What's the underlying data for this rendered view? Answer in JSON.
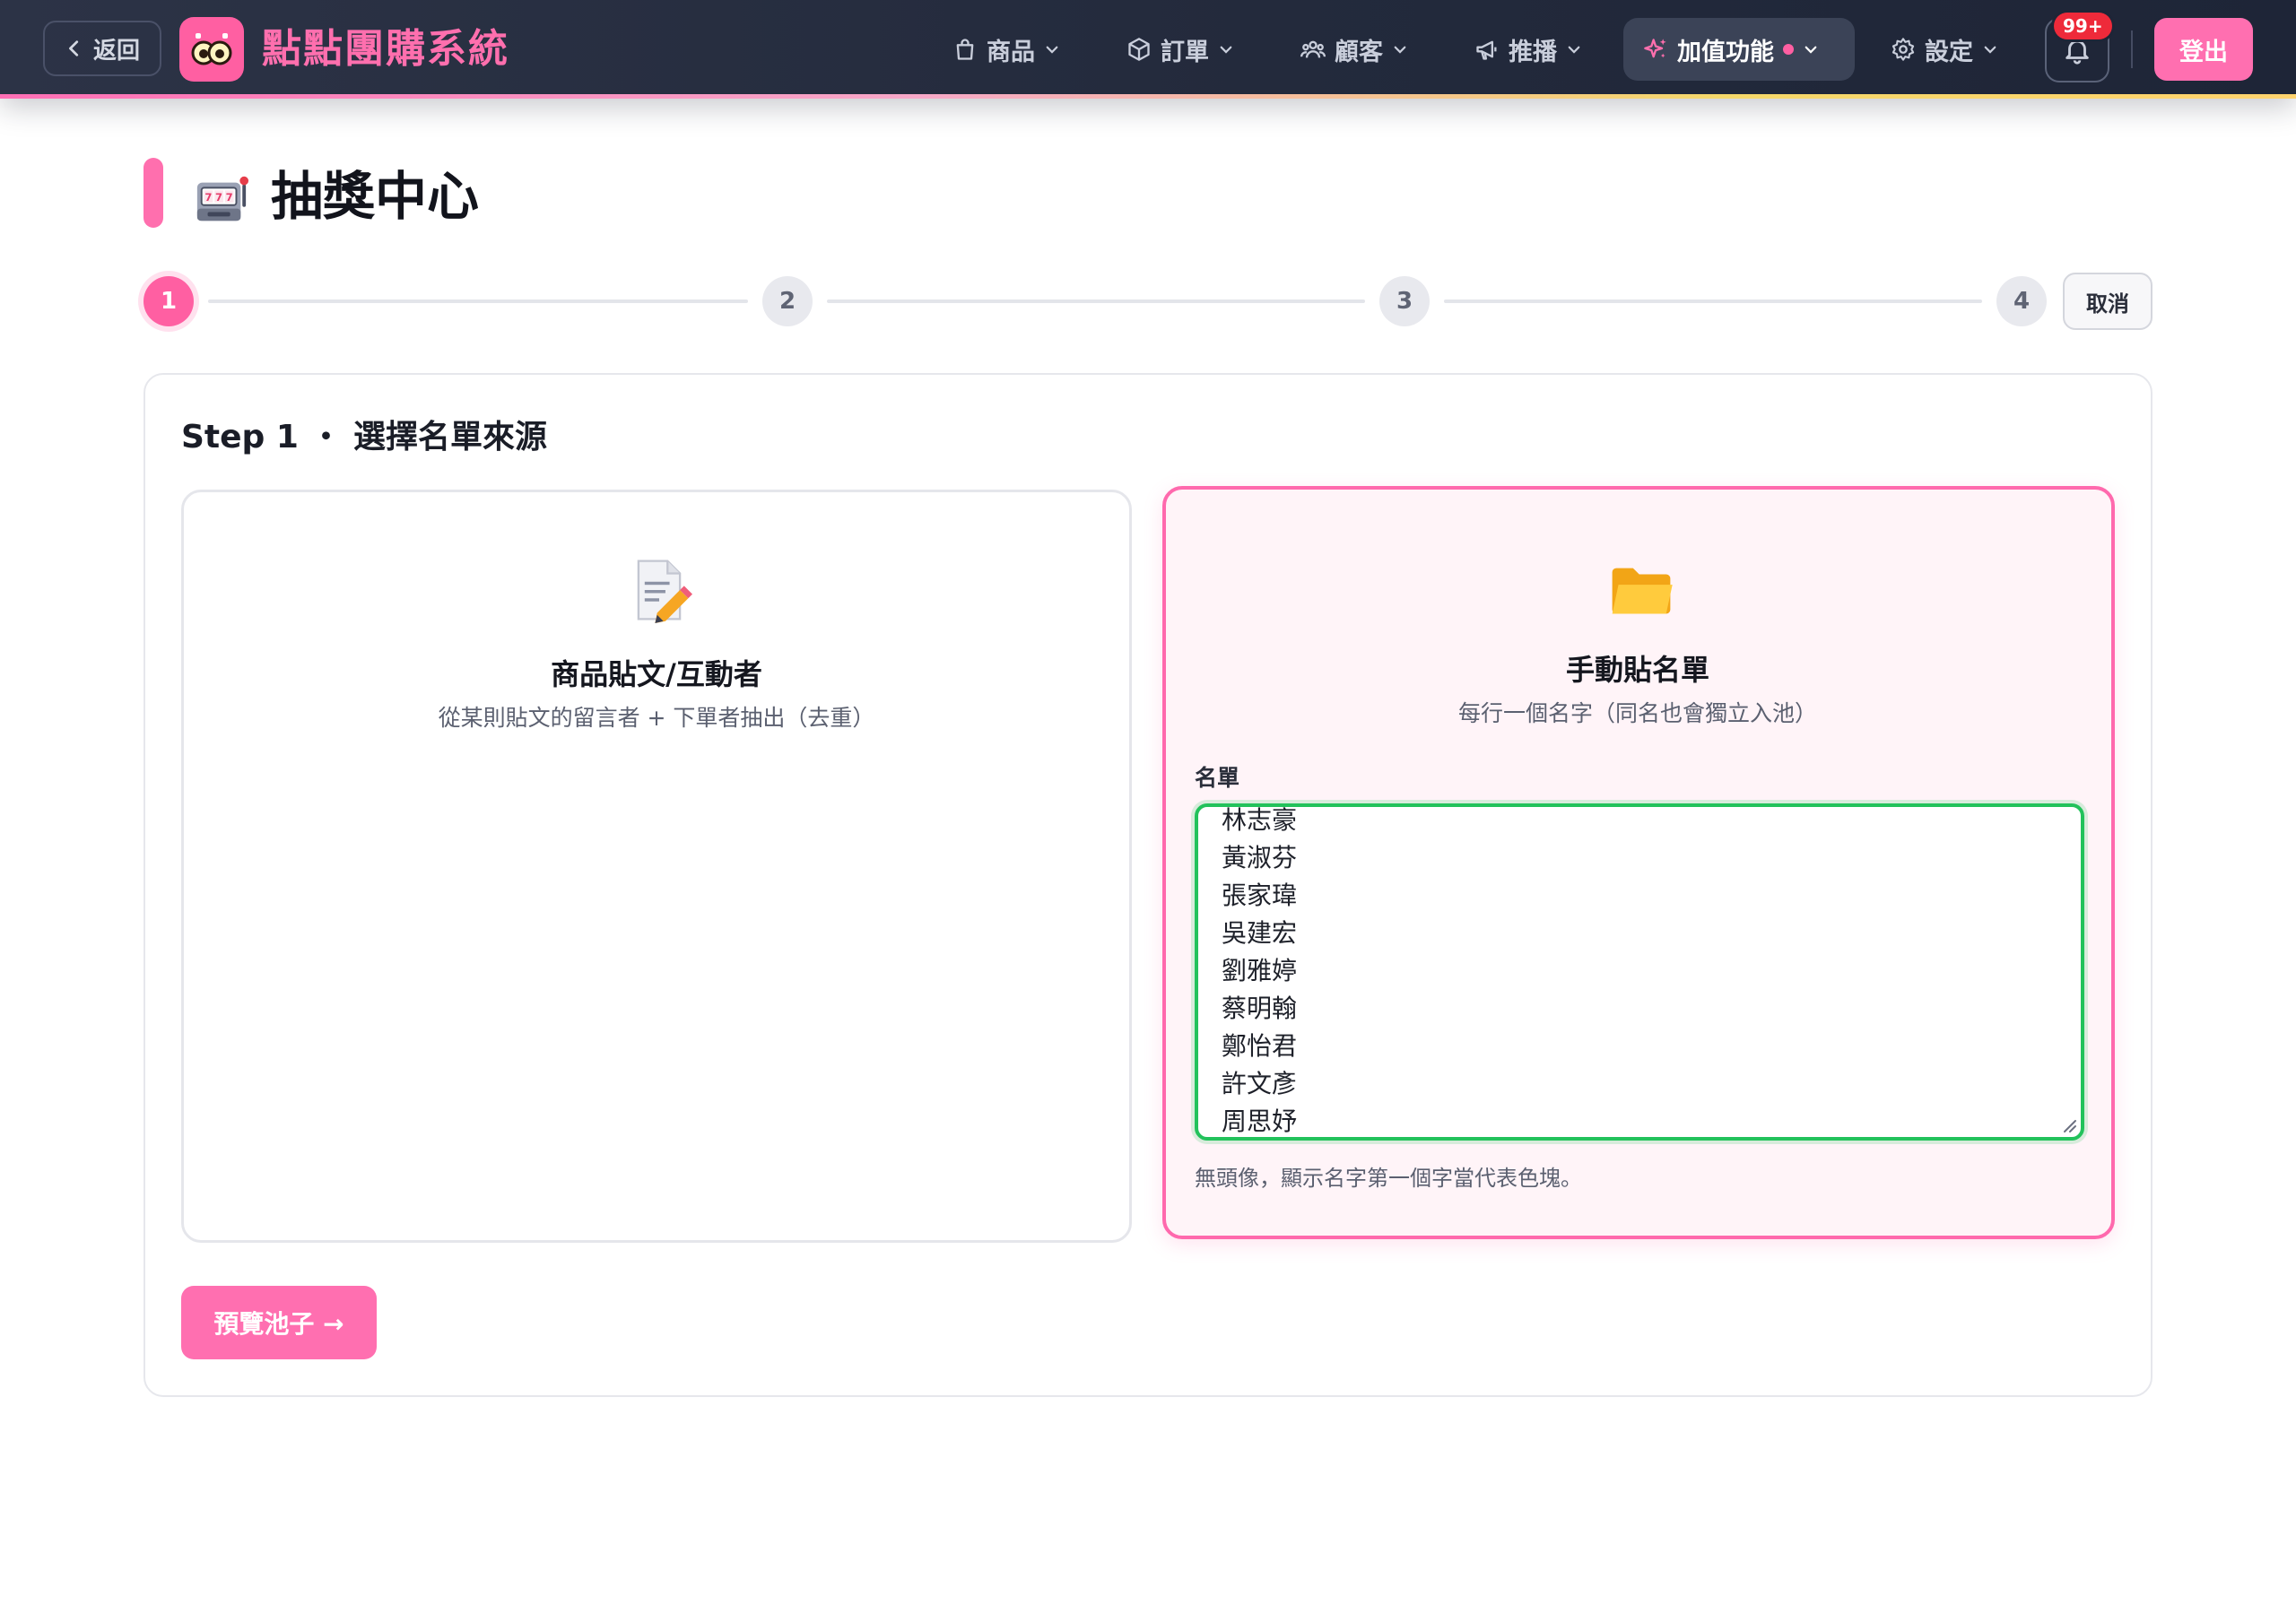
{
  "header": {
    "back_label": "返回",
    "brand": "點點團購系統",
    "nav": [
      {
        "label": "商品",
        "icon": "shopping-bag-icon"
      },
      {
        "label": "訂單",
        "icon": "box-icon"
      },
      {
        "label": "顧客",
        "icon": "users-icon"
      },
      {
        "label": "推播",
        "icon": "megaphone-icon"
      },
      {
        "label": "加值功能",
        "icon": "sparkles-icon",
        "active": true
      },
      {
        "label": "設定",
        "icon": "gear-icon"
      }
    ],
    "notification_badge": "99+",
    "logout_label": "登出"
  },
  "page": {
    "title": "抽獎中心"
  },
  "stepper": {
    "steps": [
      "1",
      "2",
      "3",
      "4"
    ],
    "current": 1,
    "cancel_label": "取消"
  },
  "step1": {
    "heading": "Step 1 ・ 選擇名單來源",
    "options": [
      {
        "title": "商品貼文/互動者",
        "desc": "從某則貼文的留言者 + 下單者抽出（去重）",
        "icon": "memo-icon",
        "selected": false
      },
      {
        "title": "手動貼名單",
        "desc": "每行一個名字（同名也會獨立入池）",
        "icon": "folder-icon",
        "selected": true
      }
    ],
    "names_label": "名單",
    "names": [
      "林志豪",
      "黃淑芬",
      "張家瑋",
      "吳建宏",
      "劉雅婷",
      "蔡明翰",
      "鄭怡君",
      "許文彥",
      "周思妤"
    ],
    "hint": "無頭像，顯示名字第一個字當代表色塊。",
    "preview_label": "預覽池子 →"
  },
  "colors": {
    "accent": "#ff5fa2",
    "topbar": "#232a3c",
    "focus": "#22c25b"
  }
}
